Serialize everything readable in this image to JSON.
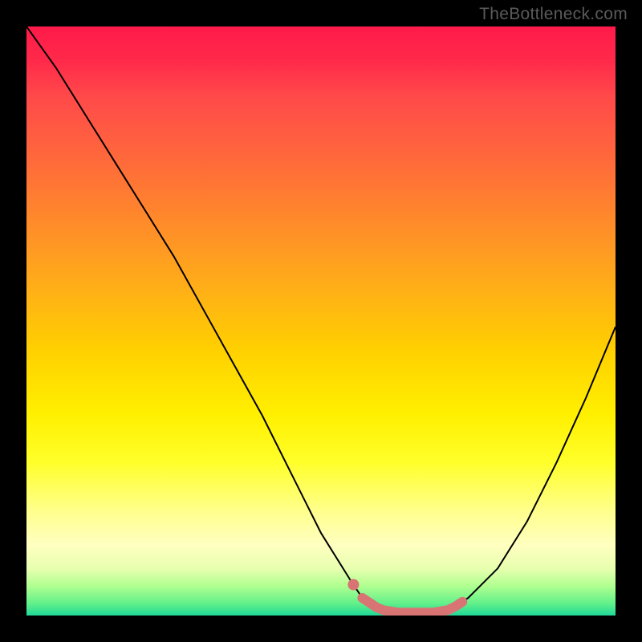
{
  "watermark": "TheBottleneck.com",
  "colors": {
    "background": "#000000",
    "curve": "#000000",
    "highlight": "#d97474"
  },
  "chart_data": {
    "type": "line",
    "title": "",
    "xlabel": "",
    "ylabel": "",
    "xlim": [
      0,
      100
    ],
    "ylim": [
      0,
      100
    ],
    "x": [
      0,
      5,
      10,
      15,
      20,
      25,
      30,
      35,
      40,
      45,
      50,
      55,
      57,
      60,
      63,
      66,
      69,
      72,
      75,
      80,
      85,
      90,
      95,
      100
    ],
    "values": [
      100,
      93,
      85,
      77,
      69,
      61,
      52,
      43,
      34,
      24,
      14,
      6,
      3,
      1,
      0.5,
      0.5,
      0.5,
      1,
      3,
      8,
      16,
      26,
      37,
      49
    ],
    "background_gradient": {
      "top": "#ff1a4a",
      "mid_upper": "#ffaa1a",
      "mid": "#ffff2a",
      "mid_lower": "#b0ff90",
      "bottom": "#20d898"
    },
    "highlight_range_x": [
      57,
      74
    ],
    "annotations": []
  }
}
